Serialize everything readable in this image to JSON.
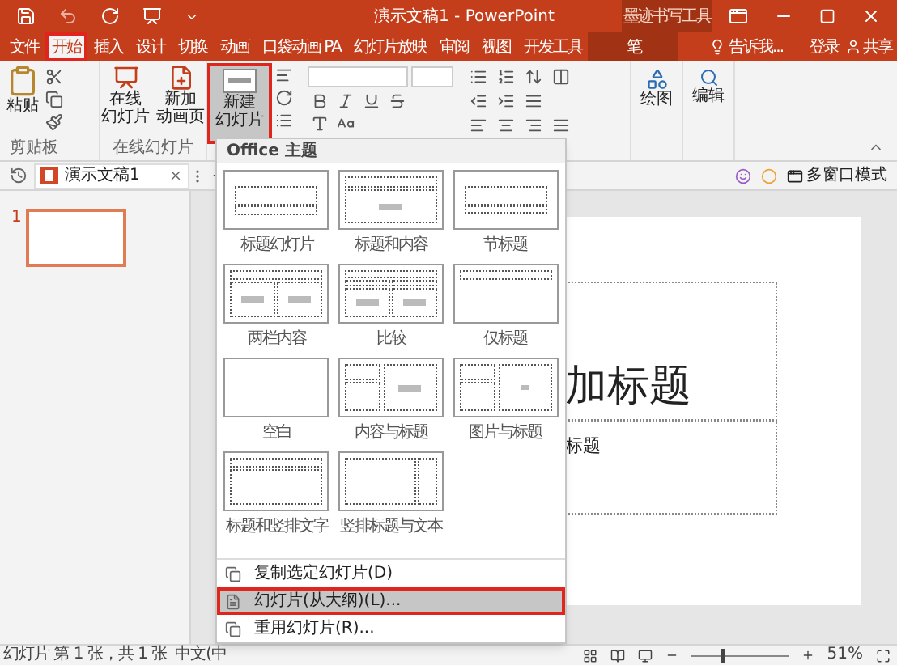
{
  "title_bar": {
    "title": "演示文稿1 - PowerPoint",
    "context_tab": "墨迹书写工具"
  },
  "tabs": [
    {
      "label": "文件",
      "selected": false,
      "highlighted": false,
      "kind": "file"
    },
    {
      "label": "开始",
      "selected": true,
      "highlighted": true,
      "kind": "normal"
    },
    {
      "label": "插入",
      "selected": false,
      "highlighted": false,
      "kind": "normal"
    },
    {
      "label": "设计",
      "selected": false,
      "highlighted": false,
      "kind": "normal"
    },
    {
      "label": "切换",
      "selected": false,
      "highlighted": false,
      "kind": "normal"
    },
    {
      "label": "动画",
      "selected": false,
      "highlighted": false,
      "kind": "normal"
    },
    {
      "label": "口袋动画 PA",
      "selected": false,
      "highlighted": false,
      "kind": "normal"
    },
    {
      "label": "幻灯片放映",
      "selected": false,
      "highlighted": false,
      "kind": "normal"
    },
    {
      "label": "审阅",
      "selected": false,
      "highlighted": false,
      "kind": "normal"
    },
    {
      "label": "视图",
      "selected": false,
      "highlighted": false,
      "kind": "normal"
    },
    {
      "label": "开发工具",
      "selected": false,
      "highlighted": false,
      "kind": "normal"
    },
    {
      "label": "笔",
      "selected": false,
      "highlighted": false,
      "kind": "context"
    }
  ],
  "tell_me": {
    "placeholder": "告诉我..."
  },
  "sign_in": "登录",
  "share": "共享",
  "ribbon": {
    "paste": "粘贴",
    "clipboard_label": "剪贴板",
    "online_slides": [
      "在线",
      "幻灯片"
    ],
    "new_animation_page": [
      "新加",
      "动画页"
    ],
    "online_label": "在线幻灯片",
    "new_slide": {
      "label": [
        "新建",
        "幻灯片"
      ],
      "highlighted": true
    },
    "drawing": "绘图",
    "editing": "编辑"
  },
  "doc_tabs": {
    "document": "演示文稿1",
    "multi_window": "多窗口模式"
  },
  "slides_panel": {
    "number": "1"
  },
  "slide": {
    "title": "加标题",
    "subtitle": "标题"
  },
  "new_slide_menu": {
    "header": "Office 主题",
    "layouts": [
      {
        "name": "标题幻灯片",
        "kind": "title"
      },
      {
        "name": "标题和内容",
        "kind": "title_content"
      },
      {
        "name": "节标题",
        "kind": "section"
      },
      {
        "name": "两栏内容",
        "kind": "two_content"
      },
      {
        "name": "比较",
        "kind": "comparison"
      },
      {
        "name": "仅标题",
        "kind": "title_only"
      },
      {
        "name": "空白",
        "kind": "blank"
      },
      {
        "name": "内容与标题",
        "kind": "content_caption"
      },
      {
        "name": "图片与标题",
        "kind": "picture_caption"
      },
      {
        "name": "标题和竖排文字",
        "kind": "vertical_text"
      },
      {
        "name": "竖排标题与文本",
        "kind": "vertical_title"
      }
    ],
    "items": [
      {
        "label": "复制选定幻灯片(D)",
        "selected": false,
        "highlighted": false
      },
      {
        "label": "幻灯片(从大纲)(L)...",
        "selected": true,
        "highlighted": true
      },
      {
        "label": "重用幻灯片(R)...",
        "selected": false,
        "highlighted": false
      }
    ]
  },
  "status_bar": {
    "slide_info": "幻灯片 第 1 张，共 1 张",
    "language": "中文(中",
    "zoom": "51%",
    "zoom_slider": {
      "level": 0.3
    }
  }
}
